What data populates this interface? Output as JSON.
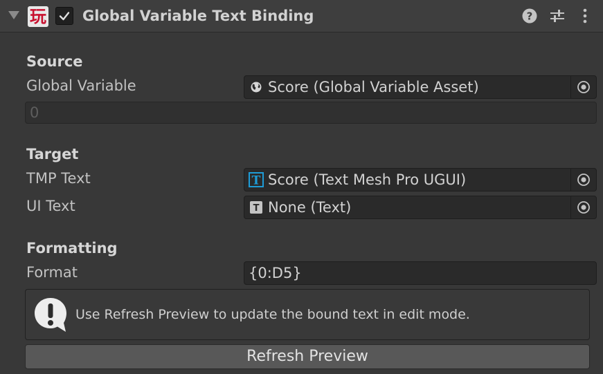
{
  "component": {
    "title": "Global Variable Text Binding",
    "icon_glyph": "玩",
    "enabled": true,
    "header_icons": [
      "help-icon",
      "preset-sliders-icon",
      "more-options-icon"
    ]
  },
  "source": {
    "section_label": "Source",
    "global_variable": {
      "label": "Global Variable",
      "value": "Score (Global Variable Asset)",
      "icon": "globe-icon"
    },
    "preview_value": "0"
  },
  "target": {
    "section_label": "Target",
    "tmp_text": {
      "label": "TMP Text",
      "value": "Score (Text Mesh Pro UGUI)",
      "icon": "tmp-text-icon"
    },
    "ui_text": {
      "label": "UI Text",
      "value": "None (Text)",
      "icon": "text-icon"
    }
  },
  "formatting": {
    "section_label": "Formatting",
    "format": {
      "label": "Format",
      "value": "{0:D5}"
    }
  },
  "help_box": {
    "message": "Use Refresh Preview to update the bound text in edit mode.",
    "icon": "info-warning-icon"
  },
  "refresh_button": {
    "label": "Refresh Preview"
  },
  "colors": {
    "background": "#383838",
    "header": "#3e3e3e",
    "field": "#2a2a2a",
    "tmp_icon_accent": "#1e9cd7",
    "component_icon_red": "#c8102e"
  }
}
